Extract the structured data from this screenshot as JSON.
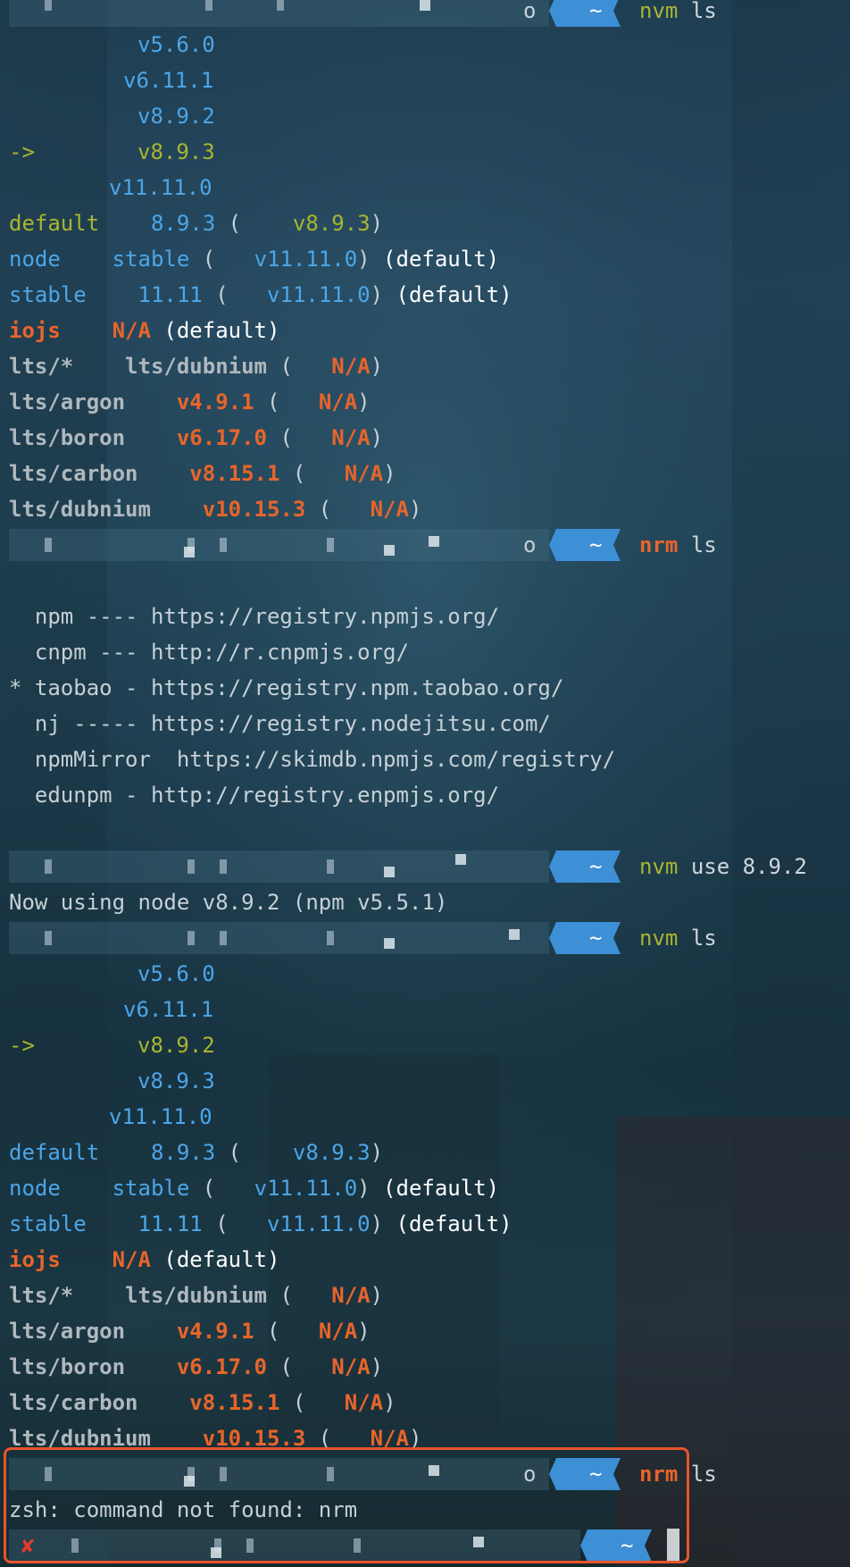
{
  "block1": {
    "prompt_tail": "o",
    "cmd": "nvm",
    "arg": "ls",
    "versions": [
      "v5.6.0",
      "v6.11.1",
      "v8.9.2",
      "v8.9.3",
      "v11.11.0"
    ],
    "arrow": "->",
    "aliases": [
      {
        "name": "default",
        "val": "8.9.3",
        "open": "(",
        "ver": "v8.9.3",
        "close": ")",
        "suffix": ""
      },
      {
        "name": "node",
        "val": "stable",
        "open": "(",
        "ver": "v11.11.0",
        "close": ")",
        "suffix": " (default)"
      },
      {
        "name": "stable",
        "val": "11.11",
        "open": "(",
        "ver": "v11.11.0",
        "close": ")",
        "suffix": " (default)"
      }
    ],
    "iojs": {
      "name": "iojs",
      "val": "N/A",
      "suffix": " (default)"
    },
    "lts": [
      {
        "name": "lts/*",
        "val": "lts/dubnium",
        "na": "N/A"
      },
      {
        "name": "lts/argon",
        "val": "v4.9.1",
        "na": "N/A"
      },
      {
        "name": "lts/boron",
        "val": "v6.17.0",
        "na": "N/A"
      },
      {
        "name": "lts/carbon",
        "val": "v8.15.1",
        "na": "N/A"
      },
      {
        "name": "lts/dubnium",
        "val": "v10.15.3",
        "na": "N/A"
      }
    ]
  },
  "block2": {
    "prompt_tail": "o",
    "cmd": "nrm",
    "arg": "ls",
    "registries": [
      "  npm ---- https://registry.npmjs.org/",
      "  cnpm --- http://r.cnpmjs.org/",
      "* taobao - https://registry.npm.taobao.org/",
      "  nj ----- https://registry.nodejitsu.com/",
      "  npmMirror  https://skimdb.npmjs.com/registry/",
      "  edunpm - http://registry.enpmjs.org/"
    ]
  },
  "block3": {
    "cmd": "nvm",
    "arg": "use 8.9.2",
    "output": "Now using node v8.9.2 (npm v5.5.1)"
  },
  "block4": {
    "cmd": "nvm",
    "arg": "ls"
  },
  "block5": {
    "prompt_tail": "o",
    "cmd": "nrm",
    "arg": "ls",
    "error": "zsh: command not found: nrm",
    "fail_mark": "✘"
  },
  "tilde": "~",
  "colors": {
    "prompt_segment": "#3d8fd6",
    "version_blue": "#4ca6e8",
    "current_yellow": "#a9b531",
    "na_orange": "#e8652b",
    "highlight_border": "#e8552a"
  }
}
